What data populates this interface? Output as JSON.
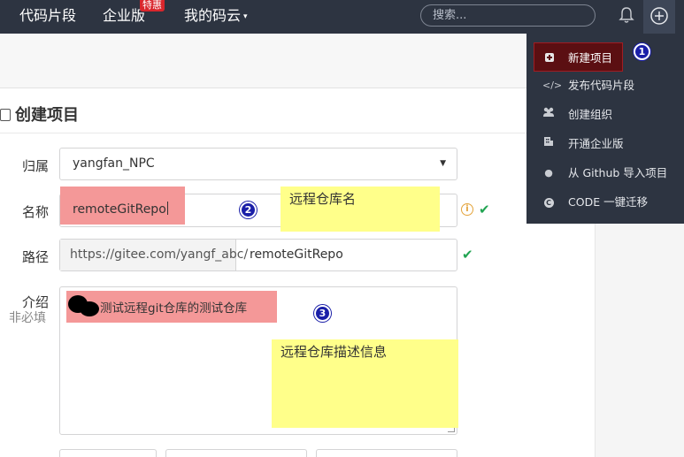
{
  "nav": {
    "code_snippets": "代码片段",
    "enterprise": "企业版",
    "hot_badge": "特惠",
    "my_gitee": "我的码云",
    "my_gitee_caret": "▾",
    "search_placeholder": "搜索..."
  },
  "page": {
    "title": "创建项目"
  },
  "form": {
    "owner_label": "归属",
    "owner_value": "yangfan_NPC",
    "owner_caret": "▼",
    "name_label": "名称",
    "name_value": "remoteGitRepo",
    "name_info": "i",
    "name_check": "✔",
    "path_label": "路径",
    "path_prefix": "https://gitee.com/yangf_abc/",
    "path_value": "remoteGitRepo",
    "path_check": "✔",
    "desc_label": "介绍",
    "desc_optional": "非必填",
    "desc_value": "测试远程git仓库的测试仓库"
  },
  "annotations": {
    "note_name": "远程仓库名",
    "note_desc": "远程仓库描述信息",
    "step1": "1",
    "step2": "2",
    "step3": "3"
  },
  "menu": {
    "items": [
      {
        "icon": "plus-square-icon",
        "label": "新建项目",
        "active": true
      },
      {
        "icon": "code-icon",
        "label": "发布代码片段"
      },
      {
        "icon": "users-icon",
        "label": "创建组织"
      },
      {
        "icon": "building-icon",
        "label": "开通企业版"
      },
      {
        "icon": "github-icon",
        "label": "从 Github 导入项目"
      },
      {
        "icon": "copyright-icon",
        "label": "CODE 一键迁移"
      }
    ],
    "code_glyph": "</>",
    "github_glyph": "●",
    "copyright_glyph": "C"
  },
  "colors": {
    "navbar": "#2d3441",
    "active_menu": "#5b0f12",
    "success": "#21a452",
    "annotation_pink": "#f49898",
    "annotation_yellow": "#ffff8a",
    "step_badge": "#1a1fa8"
  }
}
